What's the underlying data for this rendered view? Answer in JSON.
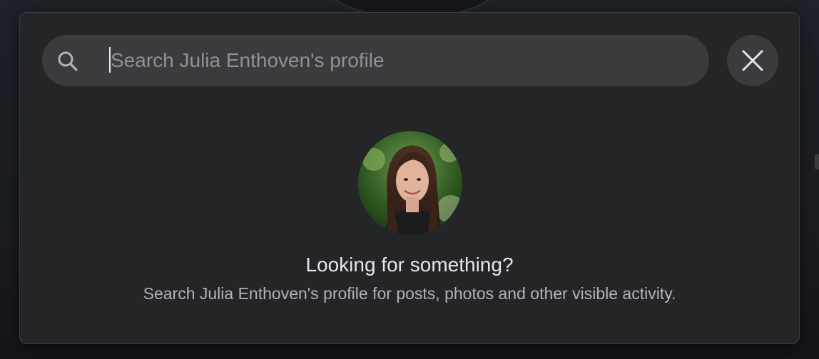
{
  "search": {
    "value": "",
    "placeholder": "Search Julia Enthoven's profile"
  },
  "empty_state": {
    "title": "Looking for something?",
    "subtitle": "Search Julia Enthoven's profile for posts, photos and other visible activity."
  },
  "icons": {
    "search": "search-icon",
    "close": "close-icon",
    "avatar": "profile-photo"
  },
  "colors": {
    "dialog_background": "#242526",
    "input_background": "#3a3b3c",
    "primary_text": "#e4e6eb",
    "secondary_text": "#b0b3b8"
  }
}
